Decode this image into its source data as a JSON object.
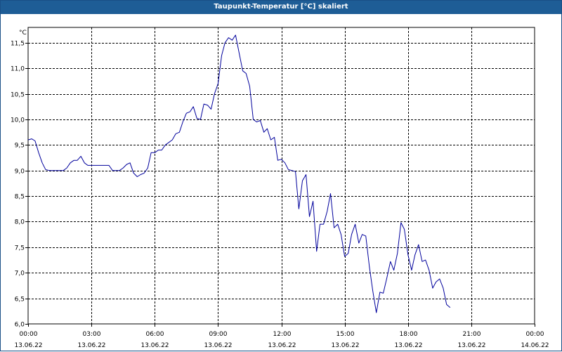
{
  "window": {
    "title": "Taupunkt-Temperatur [°C] skaliert"
  },
  "colors": {
    "title_bar": "#1e5d96",
    "series_line": "#00009c",
    "grid": "#000000"
  },
  "chart_data": {
    "type": "line",
    "title": "Taupunkt-Temperatur [°C] skaliert",
    "ylabel": "°C",
    "xlabel": "",
    "grid": true,
    "ylim": [
      6.0,
      11.8
    ],
    "xlim_hours": [
      0,
      24
    ],
    "y_ticks": [
      6.0,
      6.5,
      7.0,
      7.5,
      8.0,
      8.5,
      9.0,
      9.5,
      10.0,
      10.5,
      11.0,
      11.5
    ],
    "y_tick_labels": [
      "6,0",
      "6,5",
      "7,0",
      "7,5",
      "8,0",
      "8,5",
      "9,0",
      "9,5",
      "10,0",
      "10,5",
      "11,0",
      "11,5"
    ],
    "x_ticks": [
      {
        "hour": 0,
        "time": "00:00",
        "date": "13.06.22"
      },
      {
        "hour": 3,
        "time": "03:00",
        "date": "13.06.22"
      },
      {
        "hour": 6,
        "time": "06:00",
        "date": "13.06.22"
      },
      {
        "hour": 9,
        "time": "09:00",
        "date": "13.06.22"
      },
      {
        "hour": 12,
        "time": "12:00",
        "date": "13.06.22"
      },
      {
        "hour": 15,
        "time": "15:00",
        "date": "13.06.22"
      },
      {
        "hour": 18,
        "time": "18:00",
        "date": "13.06.22"
      },
      {
        "hour": 21,
        "time": "21:00",
        "date": "13.06.22"
      },
      {
        "hour": 24,
        "time": "00:00",
        "date": "14.06.22"
      }
    ],
    "series": [
      {
        "x_hours": [
          0.0,
          0.17,
          0.33,
          0.5,
          0.67,
          0.83,
          1.0,
          1.17,
          1.33,
          1.5,
          1.67,
          1.83,
          2.0,
          2.17,
          2.33,
          2.5,
          2.67,
          2.83,
          3.0,
          3.17,
          3.33,
          3.5,
          3.67,
          3.83,
          4.0,
          4.17,
          4.33,
          4.5,
          4.67,
          4.83,
          5.0,
          5.17,
          5.33,
          5.5,
          5.67,
          5.83,
          6.0,
          6.17,
          6.33,
          6.5,
          6.67,
          6.83,
          7.0,
          7.17,
          7.33,
          7.5,
          7.67,
          7.83,
          8.0,
          8.17,
          8.33,
          8.5,
          8.67,
          8.83,
          9.0,
          9.17,
          9.33,
          9.5,
          9.67,
          9.83,
          10.0,
          10.17,
          10.33,
          10.5,
          10.67,
          10.83,
          11.0,
          11.17,
          11.33,
          11.5,
          11.67,
          11.83,
          12.0,
          12.17,
          12.33,
          12.5,
          12.67,
          12.83,
          13.0,
          13.17,
          13.33,
          13.5,
          13.67,
          13.83,
          14.0,
          14.17,
          14.33,
          14.5,
          14.67,
          14.83,
          15.0,
          15.17,
          15.33,
          15.5,
          15.67,
          15.83,
          16.0,
          16.17,
          16.33,
          16.5,
          16.67,
          16.83,
          17.0,
          17.17,
          17.33,
          17.5,
          17.67,
          17.83,
          18.0,
          18.17,
          18.33,
          18.5,
          18.67,
          18.83,
          19.0,
          19.17,
          19.33,
          19.5,
          19.67,
          19.83,
          20.0
        ],
        "y": [
          9.6,
          9.62,
          9.58,
          9.35,
          9.15,
          9.02,
          9.0,
          9.0,
          9.0,
          9.0,
          9.0,
          9.05,
          9.15,
          9.2,
          9.2,
          9.28,
          9.15,
          9.1,
          9.1,
          9.1,
          9.1,
          9.1,
          9.1,
          9.1,
          9.0,
          9.0,
          9.0,
          9.05,
          9.12,
          9.15,
          8.95,
          8.88,
          8.92,
          8.95,
          9.05,
          9.35,
          9.35,
          9.4,
          9.4,
          9.5,
          9.55,
          9.6,
          9.72,
          9.75,
          9.95,
          10.12,
          10.15,
          10.25,
          10.02,
          10.0,
          10.3,
          10.28,
          10.2,
          10.5,
          10.7,
          11.25,
          11.5,
          11.6,
          11.55,
          11.65,
          11.3,
          10.95,
          10.9,
          10.65,
          10.0,
          9.95,
          9.98,
          9.75,
          9.82,
          9.6,
          9.65,
          9.2,
          9.22,
          9.15,
          9.02,
          9.0,
          8.98,
          8.25,
          8.8,
          8.92,
          8.1,
          8.4,
          7.42,
          7.95,
          7.95,
          8.2,
          8.55,
          7.88,
          7.95,
          7.75,
          7.32,
          7.38,
          7.75,
          7.95,
          7.58,
          7.75,
          7.72,
          7.12,
          6.65,
          6.22,
          6.62,
          6.6,
          6.9,
          7.22,
          7.05,
          7.38,
          7.98,
          7.85,
          7.35,
          7.05,
          7.35,
          7.55,
          7.22,
          7.25,
          7.05,
          6.7,
          6.82,
          6.88,
          6.7,
          6.38,
          6.32
        ]
      }
    ]
  }
}
